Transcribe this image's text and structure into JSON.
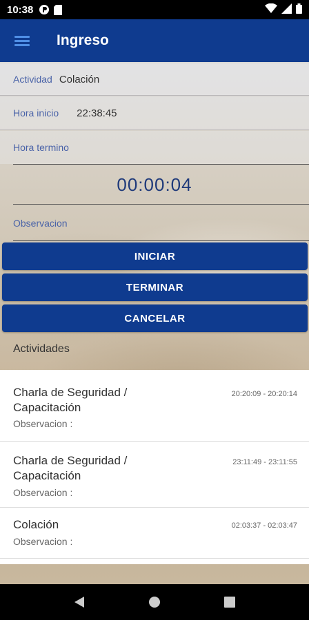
{
  "status_bar": {
    "time": "10:38",
    "icons": [
      "app-notification-icon",
      "sd-card-icon",
      "wifi-icon",
      "signal-icon",
      "battery-icon"
    ]
  },
  "app_bar": {
    "title": "Ingreso",
    "menu_icon": "hamburger-menu-icon",
    "color": "#0f3b8f"
  },
  "form": {
    "actividad_label": "Actividad",
    "actividad_value": "Colación",
    "hora_inicio_label": "Hora inicio",
    "hora_inicio_value": "22:38:45",
    "hora_termino_label": "Hora termino",
    "timer": "00:00:04",
    "observacion_label": "Observacion"
  },
  "buttons": {
    "iniciar": "INICIAR",
    "terminar": "TERMINAR",
    "cancelar": "CANCELAR"
  },
  "activities": {
    "title": "Actividades",
    "items": [
      {
        "title": "Charla de Seguridad / Capacitación",
        "time_range": "20:20:09 - 20:20:14",
        "observacion": "Observacion :"
      },
      {
        "title": "Charla de Seguridad / Capacitación",
        "time_range": "23:11:49 - 23:11:55",
        "observacion": "Observacion :"
      },
      {
        "title": "Colación",
        "time_range": "02:03:37 - 02:03:47",
        "observacion": "Observacion :"
      }
    ]
  },
  "nav_bar": {
    "icons": [
      "back-icon",
      "home-icon",
      "recents-icon"
    ]
  }
}
